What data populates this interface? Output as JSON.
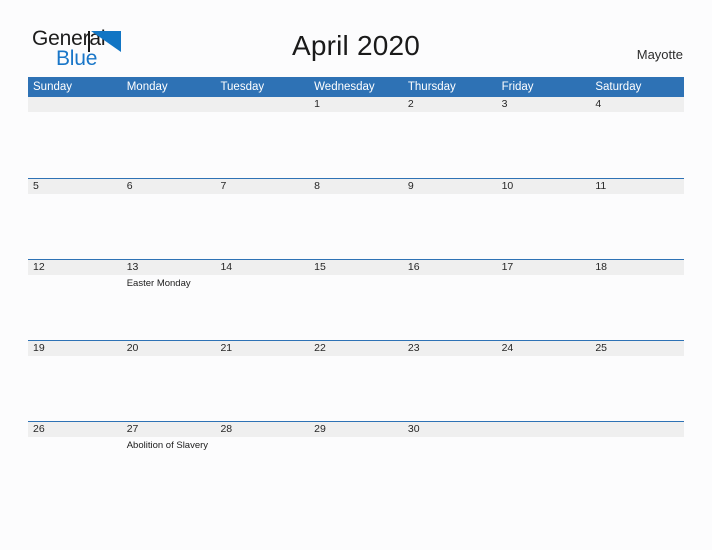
{
  "brand": {
    "name_part1": "General",
    "name_part2": "Blue",
    "mark_icon": "triangle-flag-icon"
  },
  "header": {
    "title": "April 2020",
    "region": "Mayotte"
  },
  "calendar": {
    "weekdays": [
      "Sunday",
      "Monday",
      "Tuesday",
      "Wednesday",
      "Thursday",
      "Friday",
      "Saturday"
    ],
    "colors": {
      "header_blue": "#2e72b5",
      "day_band_gray": "#efefef",
      "page_background": "#fcfcfd",
      "brand_blue": "#1976c8"
    },
    "weeks": [
      [
        {
          "day": "",
          "events": []
        },
        {
          "day": "",
          "events": []
        },
        {
          "day": "",
          "events": []
        },
        {
          "day": "1",
          "events": []
        },
        {
          "day": "2",
          "events": []
        },
        {
          "day": "3",
          "events": []
        },
        {
          "day": "4",
          "events": []
        }
      ],
      [
        {
          "day": "5",
          "events": []
        },
        {
          "day": "6",
          "events": []
        },
        {
          "day": "7",
          "events": []
        },
        {
          "day": "8",
          "events": []
        },
        {
          "day": "9",
          "events": []
        },
        {
          "day": "10",
          "events": []
        },
        {
          "day": "11",
          "events": []
        }
      ],
      [
        {
          "day": "12",
          "events": []
        },
        {
          "day": "13",
          "events": [
            "Easter Monday"
          ]
        },
        {
          "day": "14",
          "events": []
        },
        {
          "day": "15",
          "events": []
        },
        {
          "day": "16",
          "events": []
        },
        {
          "day": "17",
          "events": []
        },
        {
          "day": "18",
          "events": []
        }
      ],
      [
        {
          "day": "19",
          "events": []
        },
        {
          "day": "20",
          "events": []
        },
        {
          "day": "21",
          "events": []
        },
        {
          "day": "22",
          "events": []
        },
        {
          "day": "23",
          "events": []
        },
        {
          "day": "24",
          "events": []
        },
        {
          "day": "25",
          "events": []
        }
      ],
      [
        {
          "day": "26",
          "events": []
        },
        {
          "day": "27",
          "events": [
            "Abolition of Slavery"
          ]
        },
        {
          "day": "28",
          "events": []
        },
        {
          "day": "29",
          "events": []
        },
        {
          "day": "30",
          "events": []
        },
        {
          "day": "",
          "events": []
        },
        {
          "day": "",
          "events": []
        }
      ]
    ]
  }
}
